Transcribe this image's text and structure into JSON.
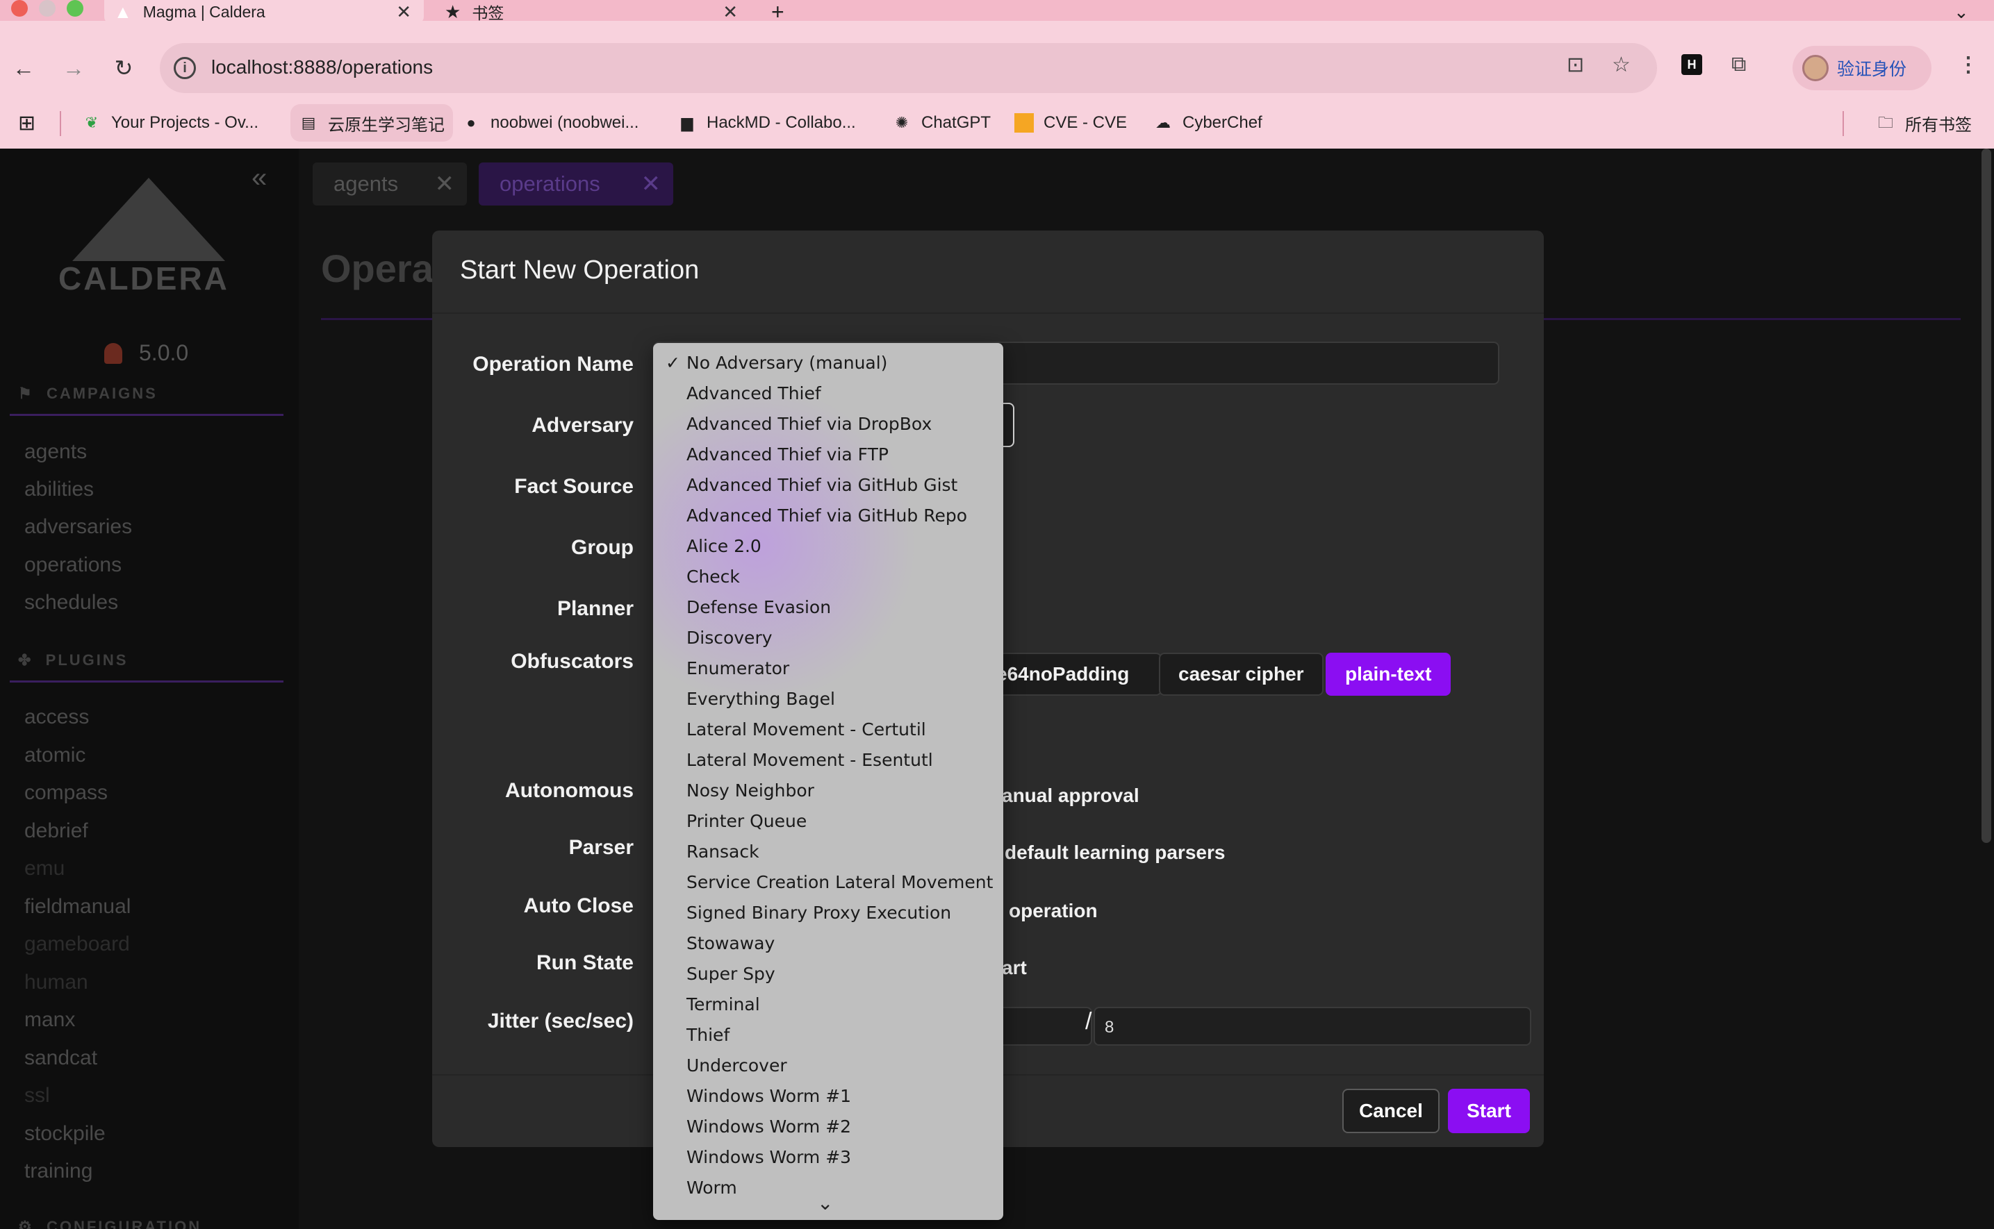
{
  "browser": {
    "tabs": [
      {
        "title": "Magma | Caldera",
        "active": true
      },
      {
        "title": "书签",
        "active": false
      }
    ],
    "url": "localhost:8888/operations",
    "profile_label": "验证身份",
    "bookmarks": [
      {
        "label": "Your Projects - Ov...",
        "icon": "leaf-icon"
      },
      {
        "label": "云原生学习笔记",
        "icon": "doc-icon"
      },
      {
        "label": "noobwei (noobwei...",
        "icon": "github-icon"
      },
      {
        "label": "HackMD - Collabo...",
        "icon": "doc-icon"
      },
      {
        "label": "ChatGPT",
        "icon": "chatgpt-icon"
      },
      {
        "label": "CVE - CVE",
        "icon": "cve-icon"
      },
      {
        "label": "CyberChef",
        "icon": "chef-icon"
      }
    ],
    "all_bookmarks_label": "所有书签",
    "colors": {
      "chrome_bg": "#f8d2dd",
      "tabstrip_bg": "#f3b9c9"
    }
  },
  "sidebar": {
    "logo_text": "CALDERA",
    "version": "5.0.0",
    "sections": [
      {
        "title": "CAMPAIGNS",
        "items": [
          "agents",
          "abilities",
          "adversaries",
          "operations",
          "schedules"
        ]
      },
      {
        "title": "PLUGINS",
        "items": [
          "access",
          "atomic",
          "compass",
          "debrief",
          "emu",
          "fieldmanual",
          "gameboard",
          "human",
          "manx",
          "sandcat",
          "ssl",
          "stockpile",
          "training"
        ]
      },
      {
        "title": "CONFIGURATION",
        "items": []
      }
    ]
  },
  "main": {
    "tabs": [
      {
        "label": "agents"
      },
      {
        "label": "operations"
      }
    ],
    "page_title": "Opera"
  },
  "modal": {
    "title": "Start New Operation",
    "labels": {
      "operation_name": "Operation Name",
      "adversary": "Adversary",
      "fact_source": "Fact Source",
      "group": "Group",
      "planner": "Planner",
      "obfuscators": "Obfuscators",
      "autonomous": "Autonomous",
      "parser": "Parser",
      "auto_close": "Auto Close",
      "run_state": "Run State",
      "jitter": "Jitter (sec/sec)"
    },
    "obfuscators": [
      {
        "label": "e64noPadding",
        "active": false
      },
      {
        "label": "caesar cipher",
        "active": false
      },
      {
        "label": "plain-text",
        "active": true
      }
    ],
    "autonomous_text": "anual approval",
    "parser_text": "default learning parsers",
    "auto_close_text": "operation",
    "run_state_text": "art",
    "jitter_separator": "/",
    "jitter_max": "8",
    "cancel_label": "Cancel",
    "start_label": "Start",
    "accent_color": "#8b0ef2"
  },
  "adversary_dropdown": {
    "selected": "No Adversary (manual)",
    "check_mark": "✓",
    "options": [
      "No Adversary (manual)",
      "Advanced Thief",
      "Advanced Thief via DropBox",
      "Advanced Thief via FTP",
      "Advanced Thief via GitHub Gist",
      "Advanced Thief via GitHub Repo",
      "Alice 2.0",
      "Check",
      "Defense Evasion",
      "Discovery",
      "Enumerator",
      "Everything Bagel",
      "Lateral Movement - Certutil",
      "Lateral Movement - Esentutl",
      "Nosy Neighbor",
      "Printer Queue",
      "Ransack",
      "Service Creation Lateral Movement",
      "Signed Binary Proxy Execution",
      "Stowaway",
      "Super Spy",
      "Terminal",
      "Thief",
      "Undercover",
      "Windows Worm #1",
      "Windows Worm #2",
      "Windows Worm #3",
      "Worm"
    ]
  }
}
